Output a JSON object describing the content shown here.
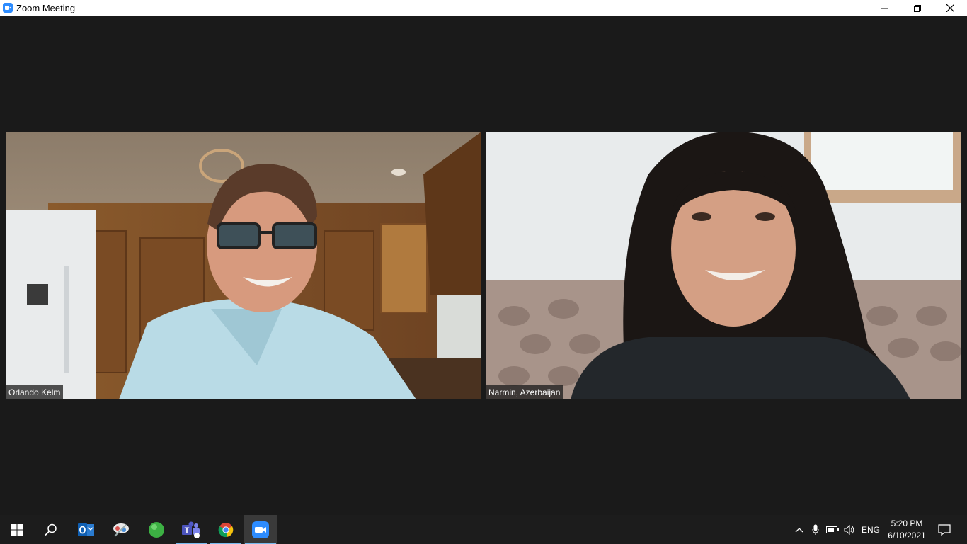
{
  "window": {
    "title": "Zoom Meeting",
    "minimize_icon": "minimize-icon",
    "restore_icon": "restore-icon",
    "close_icon": "close-icon"
  },
  "participants": [
    {
      "name": "Orlando Kelm"
    },
    {
      "name": "Narmin, Azerbaijan"
    }
  ],
  "taskbar": {
    "apps": [
      {
        "icon": "windows-start-icon"
      },
      {
        "icon": "search-icon"
      },
      {
        "icon": "outlook-icon"
      },
      {
        "icon": "snipping-tool-icon"
      },
      {
        "icon": "green-circle-app-icon"
      },
      {
        "icon": "teams-icon"
      },
      {
        "icon": "chrome-icon"
      },
      {
        "icon": "zoom-icon",
        "active": true
      }
    ],
    "tray": {
      "language": "ENG",
      "time": "5:20 PM",
      "date": "6/10/2021"
    }
  },
  "colors": {
    "background": "#1a1a1a",
    "taskbar": "#1c1c1c",
    "zoom_blue": "#2d8cff",
    "active_underline": "#76b9ed"
  }
}
